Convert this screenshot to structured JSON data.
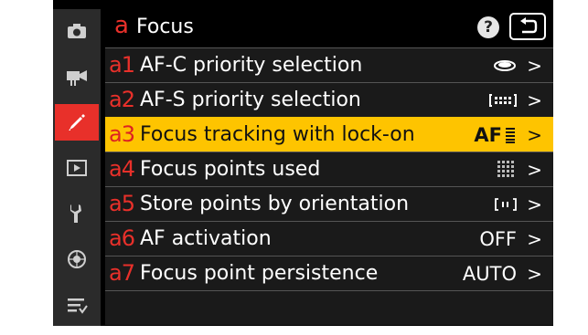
{
  "header": {
    "section_letter": "a",
    "title": "Focus",
    "help_label": "?"
  },
  "sidebar": {
    "items": [
      {
        "name": "camera-icon",
        "active": false
      },
      {
        "name": "movie-camera-icon",
        "active": false
      },
      {
        "name": "pencil-icon",
        "active": true
      },
      {
        "name": "playback-icon",
        "active": false
      },
      {
        "name": "wrench-icon",
        "active": false
      },
      {
        "name": "network-icon",
        "active": false
      },
      {
        "name": "my-menu-icon",
        "active": false
      }
    ]
  },
  "menu": {
    "items": [
      {
        "code": "a1",
        "label": "AF-C priority selection",
        "value_icon": "focus-priority-icon",
        "chevron": ">"
      },
      {
        "code": "a2",
        "label": "AF-S priority selection",
        "value_icon": "focus-release-icon",
        "chevron": ">"
      },
      {
        "code": "a3",
        "label": "Focus tracking with lock-on",
        "value": "AF",
        "value_icon": "tracking-bars-icon",
        "chevron": ">",
        "selected": true
      },
      {
        "code": "a4",
        "label": "Focus points used",
        "value_icon": "focus-grid-icon",
        "chevron": ">"
      },
      {
        "code": "a5",
        "label": "Store points by orientation",
        "value_icon": "orientation-icon",
        "chevron": ">"
      },
      {
        "code": "a6",
        "label": "AF activation",
        "value": "OFF",
        "chevron": ">"
      },
      {
        "code": "a7",
        "label": "Focus point persistence",
        "value": "AUTO",
        "chevron": ">"
      }
    ]
  },
  "colors": {
    "accent": "#e8302a",
    "highlight": "#fec400",
    "background": "#000000",
    "sidebar": "#2b2b2b"
  }
}
